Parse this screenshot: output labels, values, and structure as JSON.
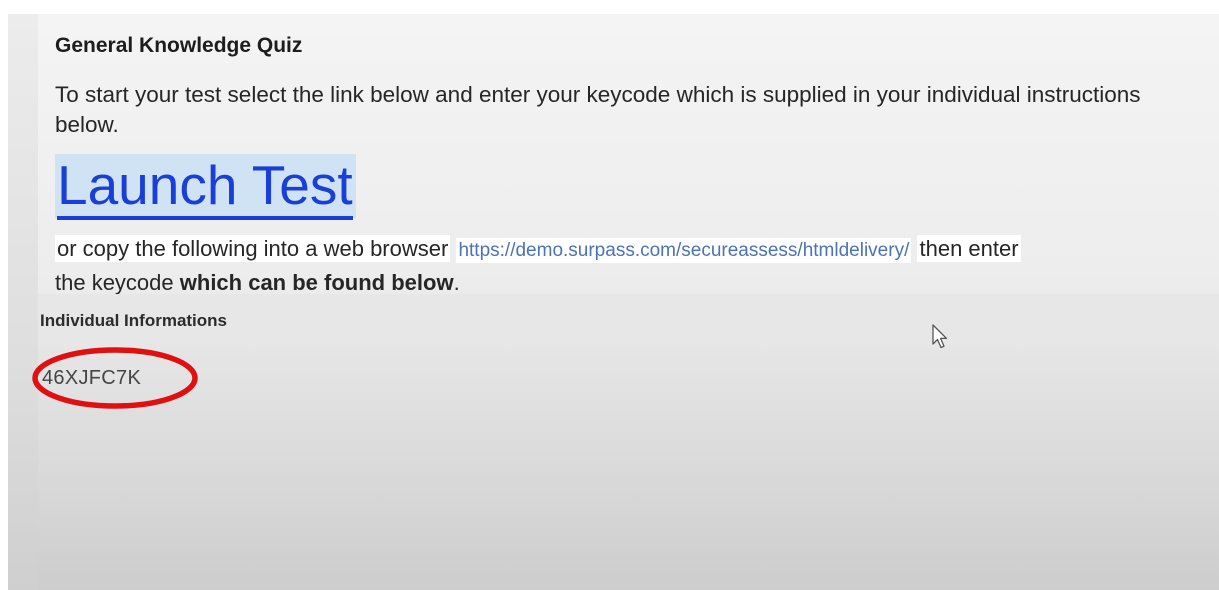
{
  "quiz": {
    "title": "General Knowledge Quiz",
    "instructions": "To start your test select the link below and enter your keycode which is supplied in your individual instructions below.",
    "launch_label": "Launch Test",
    "copy_prefix": "or copy the following into a web browser",
    "url": "https://demo.surpass.com/secureassess/htmldelivery/",
    "copy_then": "then enter",
    "copy_the_keycode": "the keycode",
    "copy_bold": "which can be found below",
    "copy_period": "."
  },
  "individual": {
    "header": "Individual Informations",
    "keycode": "46XJFC7K"
  },
  "colors": {
    "link": "#1a3fd6",
    "url": "#4c72b8",
    "annotation_ring": "#e01010"
  },
  "icons": {
    "cursor": "mouse-pointer-icon"
  }
}
